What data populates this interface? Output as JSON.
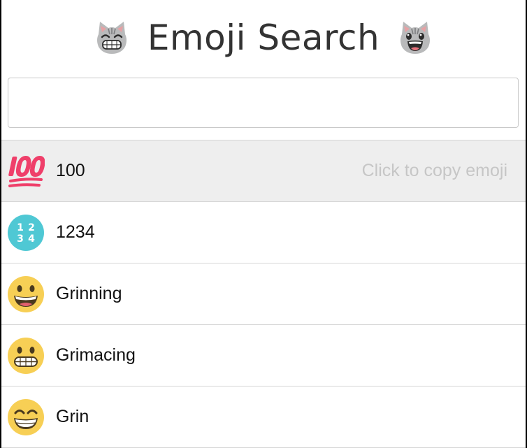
{
  "header": {
    "title": "Emoji Search",
    "left_icon": "grinning-cat-icon",
    "right_icon": "cat-open-mouth-icon"
  },
  "search": {
    "value": "",
    "placeholder": ""
  },
  "results": [
    {
      "icon": "hundred-points-icon",
      "label": "100",
      "hint": "Click to copy emoji"
    },
    {
      "icon": "input-numbers-icon",
      "label": "1234"
    },
    {
      "icon": "grinning-face-icon",
      "label": "Grinning"
    },
    {
      "icon": "grimacing-face-icon",
      "label": "Grimacing"
    },
    {
      "icon": "grin-face-icon",
      "label": "Grin"
    }
  ],
  "colors": {
    "hover_row": "#eeeeee",
    "hint_text": "#c6c6c6",
    "hundred_red": "#ef3f6a",
    "numbers_teal": "#4fc8d4",
    "face_yellow": "#f7cf55"
  }
}
